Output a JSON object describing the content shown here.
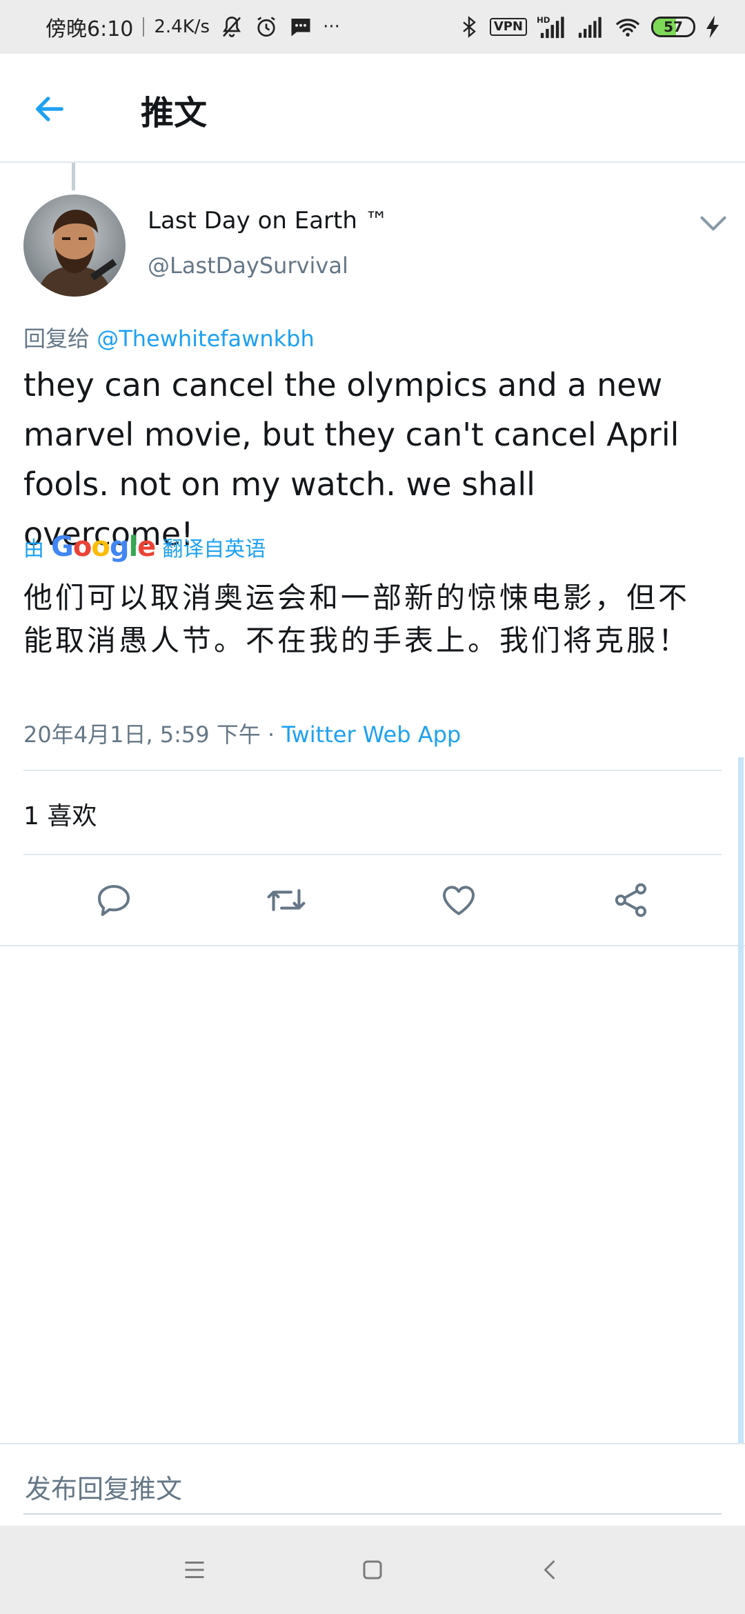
{
  "status_bar": {
    "time": "傍晚6:10",
    "speed": "2.4K/s",
    "more": "···",
    "vpn": "VPN",
    "hd": "HD",
    "battery": "57",
    "battery_level": 0.57
  },
  "header": {
    "title": "推文"
  },
  "tweet": {
    "author_name": "Last Day on Earth ™",
    "author_handle": "@LastDaySurvival",
    "reply_prefix": "回复给",
    "reply_mention": "@Thewhitefawnkbh",
    "text": "they can cancel the olympics and a new marvel movie, but they can't cancel April fools. not on my watch. we shall overcome!",
    "translated_by_prefix": "由",
    "translated_by_logo": "Google",
    "translated_by_suffix": "翻译自英语",
    "translated_text": "他们可以取消奥运会和一部新的惊悚电影，但不能取消愚人节。不在我的手表上。我们将克服！",
    "timestamp": "20年4月1日, 5:59 下午 · ",
    "source_app": "Twitter Web App",
    "likes": "1 喜欢"
  },
  "reply": {
    "placeholder": "发布回复推文"
  },
  "colors": {
    "accent": "#1da1f2",
    "secondary_text": "#657786",
    "divider": "#e1e8ed"
  },
  "icons": [
    "back-arrow-icon",
    "chevron-down-icon",
    "reply-icon",
    "retweet-icon",
    "like-icon",
    "share-icon",
    "menu-icon",
    "home-icon",
    "back-icon"
  ]
}
